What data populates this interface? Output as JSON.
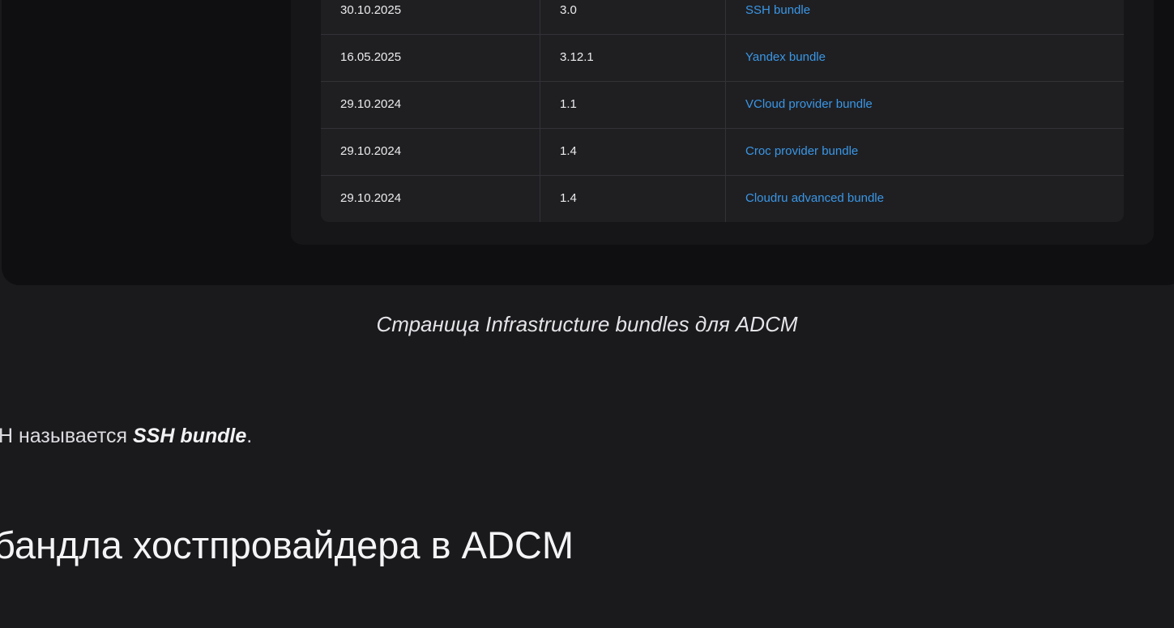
{
  "table": {
    "rows": [
      {
        "date": "30.10.2025",
        "version": "3.0",
        "name": "SSH bundle"
      },
      {
        "date": "16.05.2025",
        "version": "3.12.1",
        "name": "Yandex bundle"
      },
      {
        "date": "29.10.2024",
        "version": "1.1",
        "name": "VCloud provider bundle"
      },
      {
        "date": "29.10.2024",
        "version": "1.4",
        "name": "Croc provider bundle"
      },
      {
        "date": "29.10.2024",
        "version": "1.4",
        "name": "Cloudru advanced bundle"
      }
    ]
  },
  "caption": "Страница Infrastructure bundles для ADCM",
  "paragraph": {
    "prefix": "Н называется ",
    "emphasis": "SSH bundle",
    "suffix": "."
  },
  "heading": "бандла хостпровайдера в ADCM",
  "colors": {
    "background": "#1a191c",
    "link": "#3a97e6",
    "frame": "#0f0f11",
    "table": "#1f1f22"
  }
}
